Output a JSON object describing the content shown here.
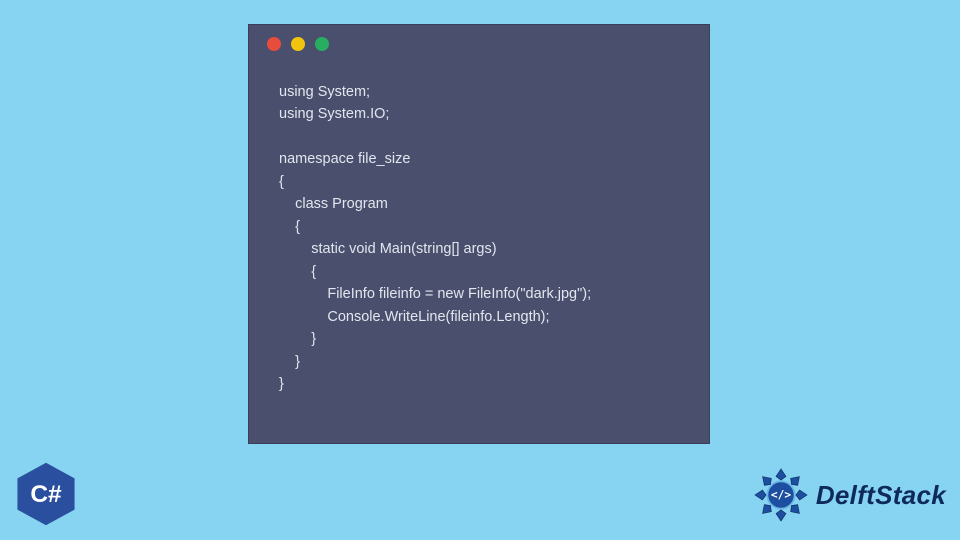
{
  "code": {
    "lines": [
      "using System;",
      "using System.IO;",
      "",
      "namespace file_size",
      "{",
      "    class Program",
      "    {",
      "        static void Main(string[] args)",
      "        {",
      "            FileInfo fileinfo = new FileInfo(\"dark.jpg\");",
      "            Console.WriteLine(fileinfo.Length);",
      "        }",
      "    }",
      "}"
    ]
  },
  "badges": {
    "csharp_label": "C#",
    "brand_name": "DelftStack"
  },
  "colors": {
    "page_bg": "#87d4f2",
    "window_bg": "#494f6d",
    "code_text": "#e3e6ee",
    "dot_red": "#e84c3d",
    "dot_yellow": "#f1c40f",
    "dot_green": "#27ae60",
    "csharp_blue": "#2a4f9e",
    "delft_accent": "#0e2a5c"
  }
}
